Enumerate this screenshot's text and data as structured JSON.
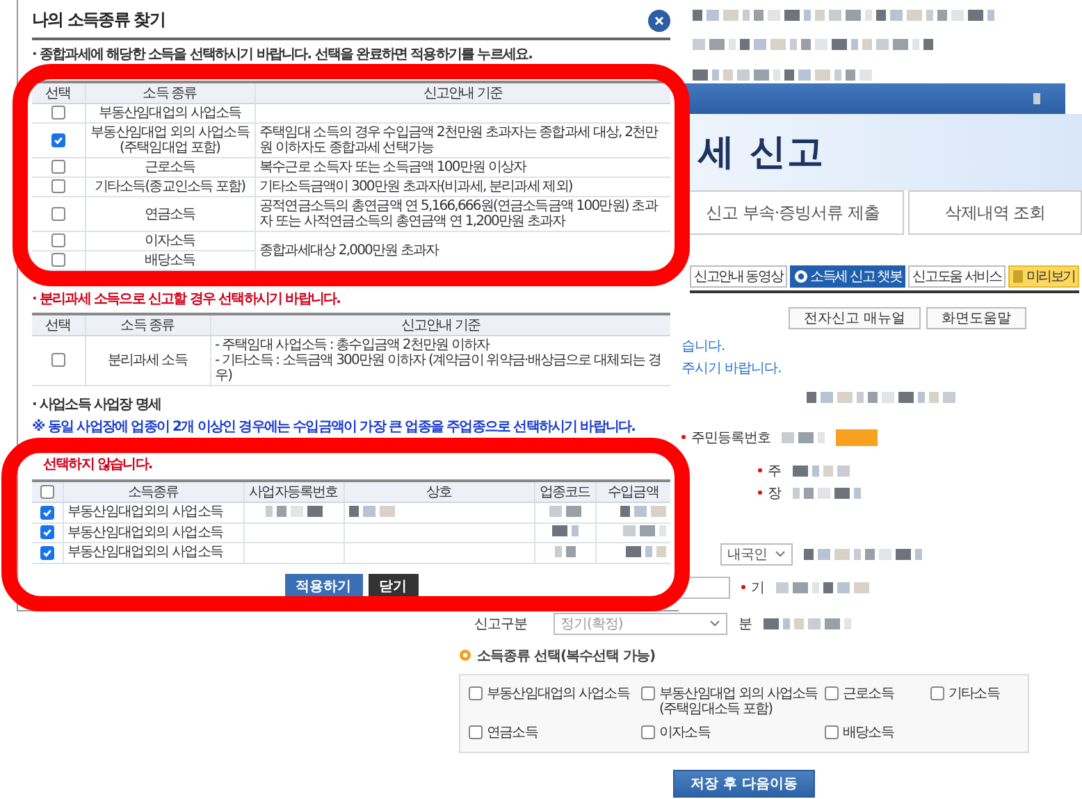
{
  "page": {
    "banner_title": "세 신고",
    "tabs": [
      {
        "label": "신고 부속·증빙서류 제출",
        "selected": false
      },
      {
        "label": "삭제내역 조회",
        "selected": false
      }
    ],
    "tool_buttons": [
      {
        "label": "신고안내 동영상",
        "kind": "plain"
      },
      {
        "label": "소득세 신고 챗봇",
        "kind": "chatbot"
      },
      {
        "label": "신고도움 서비스",
        "kind": "plain"
      },
      {
        "label": "미리보기",
        "kind": "preview"
      }
    ],
    "help_buttons": [
      "전자신고 매뉴얼",
      "화면도움말"
    ],
    "notice_lines": [
      "습니다.",
      "주시기 바랍니다."
    ],
    "id_label": "주민등록번호",
    "address_label": "주",
    "disability_label": "장",
    "nationality": "내국인",
    "period_label": "기",
    "report_type_label": "신고구분",
    "report_type_value": "정기(확정)",
    "branch_label": "분",
    "income_section": {
      "title": "소득종류 선택(복수선택 가능)",
      "options": [
        {
          "label": "부동산임대업의 사업소득",
          "checked": false
        },
        {
          "label": "부동산임대업 외의 사업소득\n(주택임대소득 포함)",
          "checked": false
        },
        {
          "label": "근로소득",
          "checked": false
        },
        {
          "label": "기타소득",
          "checked": false
        },
        {
          "label": "연금소득",
          "checked": false
        },
        {
          "label": "이자소득",
          "checked": false
        },
        {
          "label": "배당소득",
          "checked": false
        }
      ]
    },
    "save_button": "저장 후 다음이동"
  },
  "dialog": {
    "title": "나의 소득종류 찾기",
    "intro": "· 종합과세에 해당한 소득을 선택하시기 바랍니다. 선택을 완료하면 적용하기를 누르세요.",
    "income_table": {
      "columns": [
        "선택",
        "소득 종류",
        "신고안내 기준"
      ],
      "groups": [
        {
          "items": [
            {
              "label": "부동산임대업의 사업소득",
              "checked": false
            }
          ]
        },
        {
          "items": [
            {
              "label": "부동산임대업 외의 사업소득\n(주택임대업 포함)",
              "checked": true
            }
          ],
          "criteria": "주택임대 소득의 경우 수입금액 2천만원 초과자는 종합과세 대상, 2천만원 이하자도 종합과세 선택가능"
        },
        {
          "items": [
            {
              "label": "근로소득",
              "checked": false
            }
          ],
          "criteria": "복수근로 소득자 또는 소득금액 100만원 이상자"
        },
        {
          "items": [
            {
              "label": "기타소득(종교인소득 포함)",
              "checked": false
            }
          ],
          "criteria": "기타소득금액이 300만원 초과자(비과세, 분리과세 제외)"
        },
        {
          "items": [
            {
              "label": "연금소득",
              "checked": false
            }
          ],
          "criteria": "공적연금소득의 총연금액 연 5,166,666원(연금소득금액 100만원) 초과자 또는 사적연금소득의 총연금액 연 1,200만원 초과자"
        },
        {
          "items": [
            {
              "label": "이자소득",
              "checked": false
            },
            {
              "label": "배당소득",
              "checked": false
            }
          ],
          "criteria": "종합과세대상 2,000만원 초과자"
        }
      ]
    },
    "separate_note": "· 분리과세 소득으로 신고할 경우 선택하시기 바랍니다.",
    "separate_table": {
      "columns": [
        "선택",
        "소득 종류",
        "신고안내 기준"
      ],
      "rows": [
        {
          "label": "분리과세 소득",
          "checked": false,
          "criteria": [
            "- 주택임대 사업소득 : 총수입금액 2천만원 이하자",
            "- 기타소득 : 소득금액 300만원 이하자 (계약금이 위약금·배상금으로 대체되는 경우)"
          ]
        }
      ]
    },
    "business_heading": "· 사업소득 사업장 명세",
    "business_note": "※ 동일 사업장에 업종이 2개 이상인 경우에는 수입금액이 가장 큰 업종을 주업종으로 선택하시기 바랍니다.",
    "business_warning": "선택하지 않습니다.",
    "business_table": {
      "all_checked": false,
      "columns": [
        "소득종류",
        "사업자등록번호",
        "상호",
        "업종코드",
        "수입금액"
      ],
      "rows": [
        {
          "income_type": "부동산임대업외의 사업소득",
          "checked": true
        },
        {
          "income_type": "부동산임대업외의 사업소득",
          "checked": true
        },
        {
          "income_type": "부동산임대업외의 사업소득",
          "checked": true
        }
      ]
    },
    "buttons": [
      {
        "label": "적용하기",
        "kind": "primary"
      },
      {
        "label": "닫기",
        "kind": "dark"
      }
    ]
  }
}
